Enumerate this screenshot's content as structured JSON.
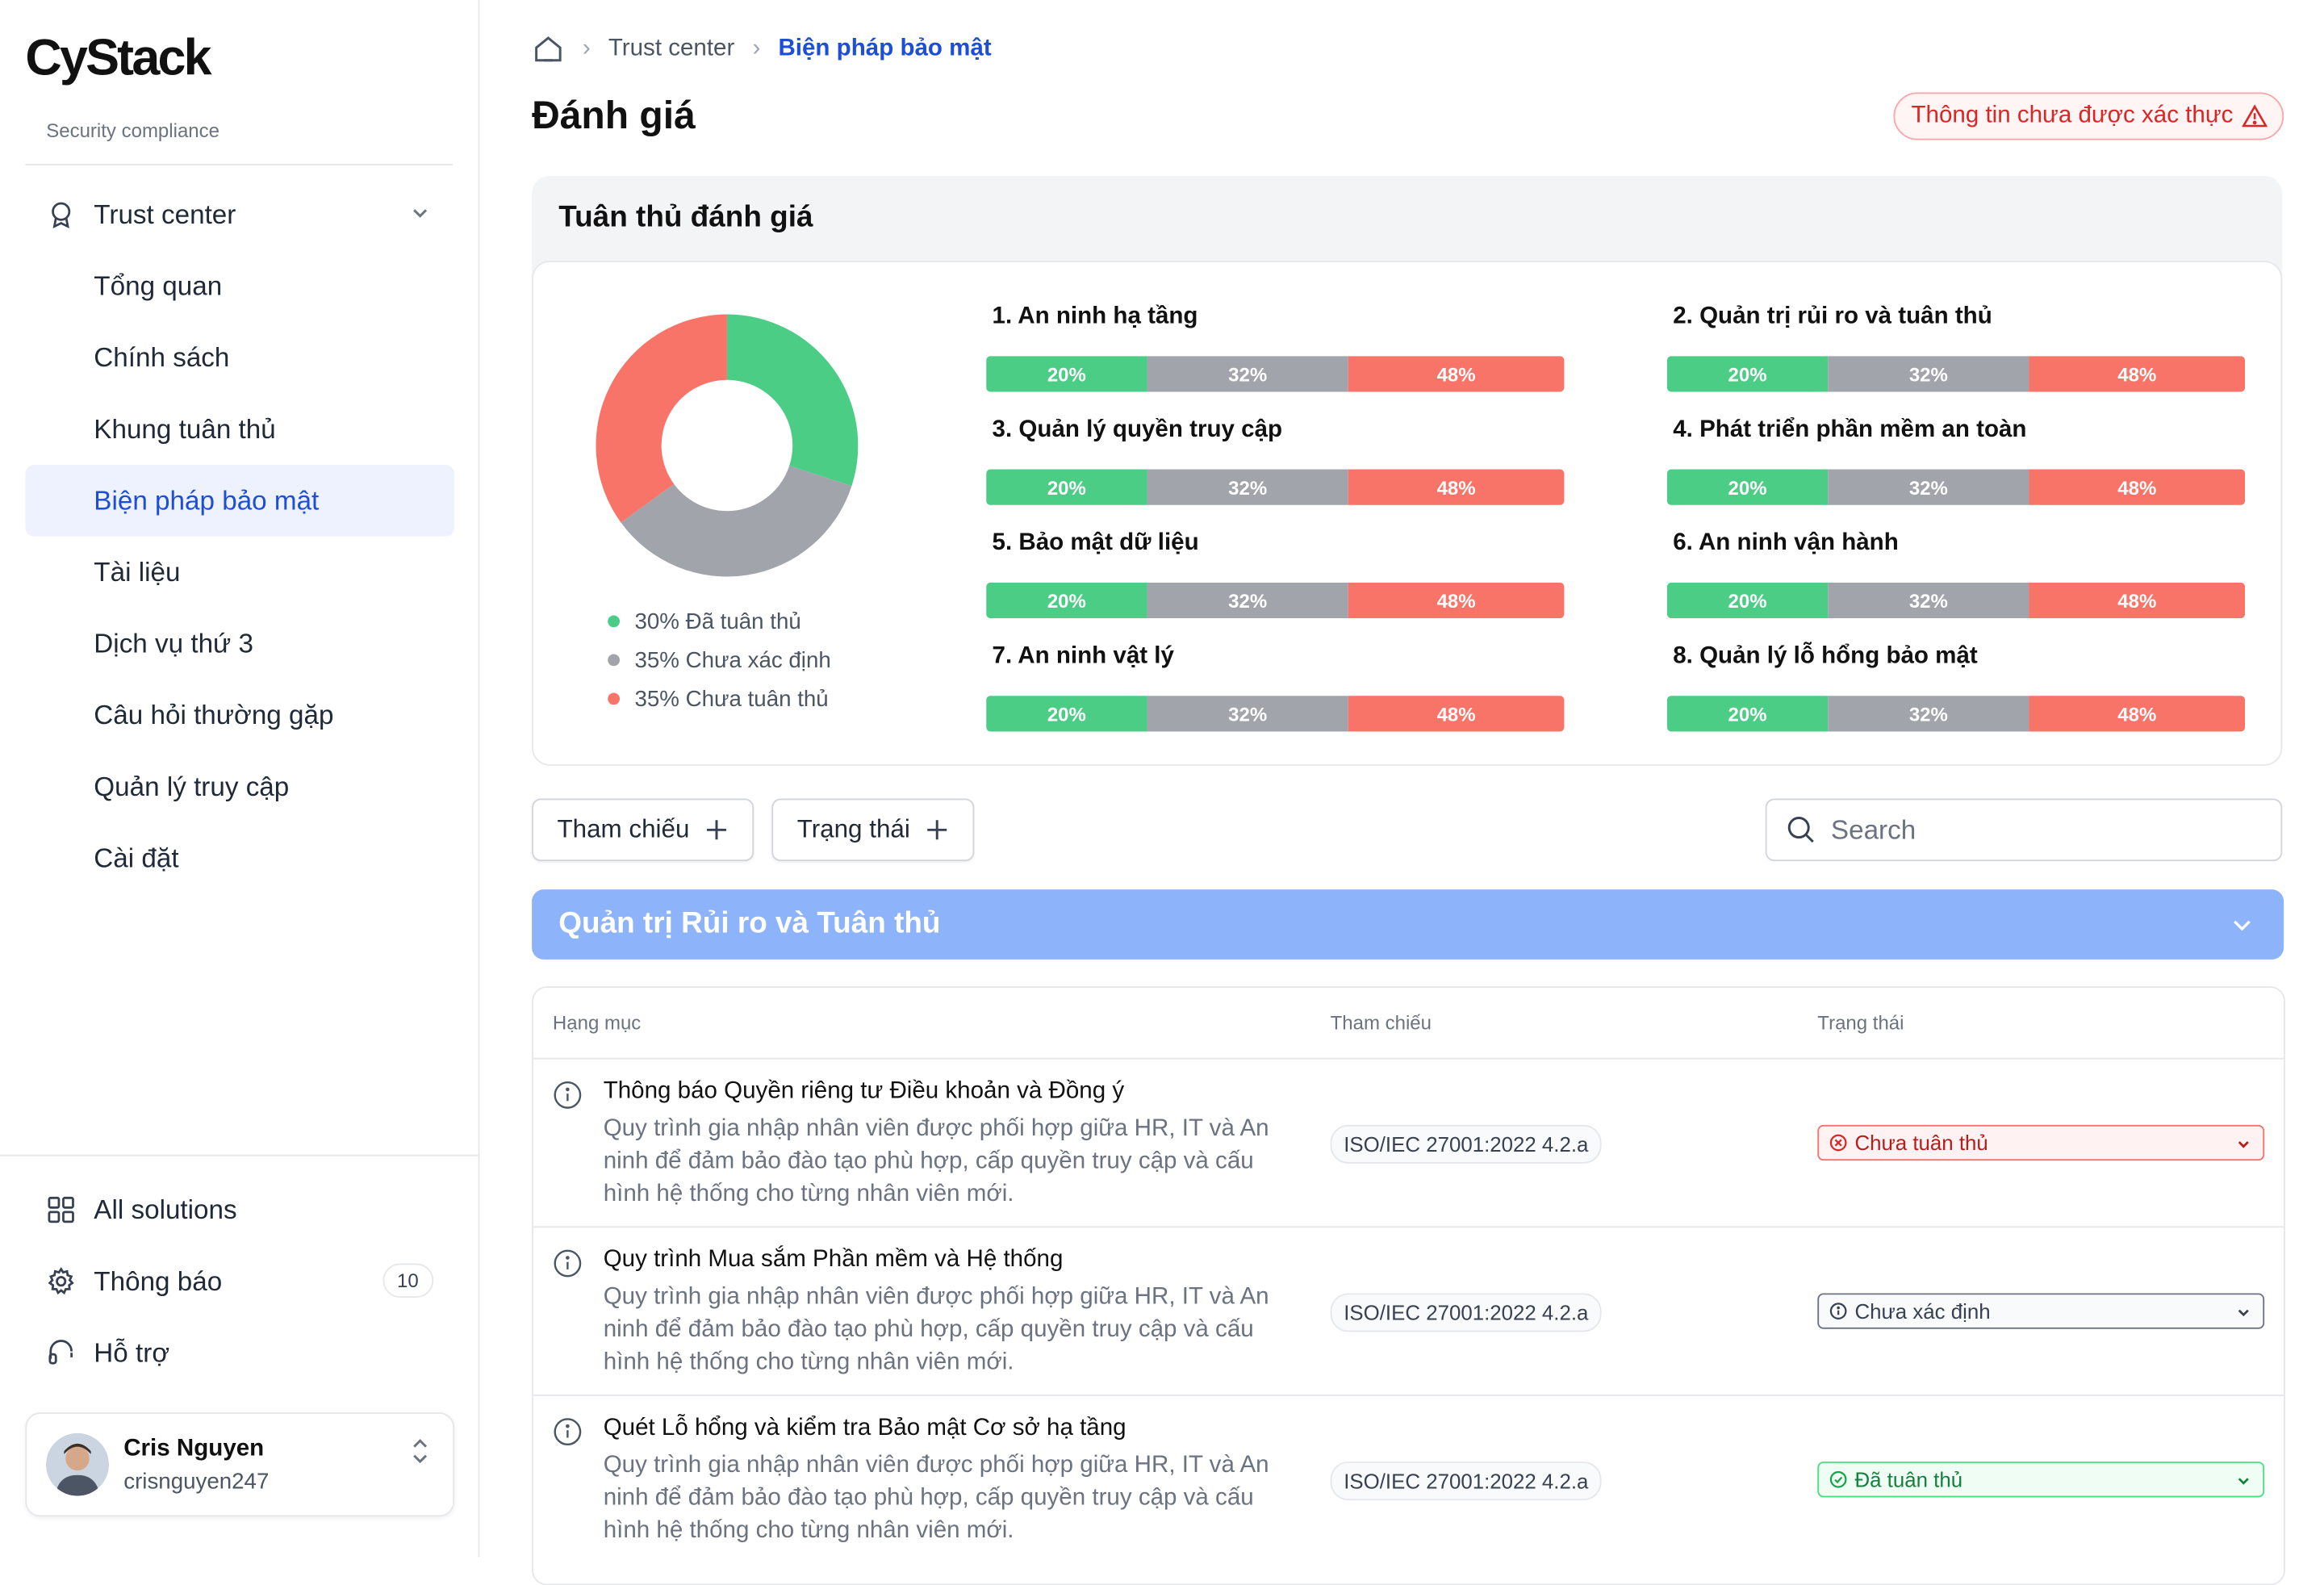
{
  "brand": {
    "logo_text": "CyStack",
    "subtitle": "Security compliance"
  },
  "sidebar": {
    "group": {
      "label": "Trust center",
      "icon": "award-icon"
    },
    "items": [
      {
        "label": "Tổng quan"
      },
      {
        "label": "Chính sách"
      },
      {
        "label": "Khung tuân thủ"
      },
      {
        "label": "Biện pháp bảo mật",
        "active": true
      },
      {
        "label": "Tài liệu"
      },
      {
        "label": "Dịch vụ thứ 3"
      },
      {
        "label": "Câu hỏi thường gặp"
      },
      {
        "label": "Quản lý truy cập"
      },
      {
        "label": "Cài đặt"
      }
    ],
    "bottom": [
      {
        "label": "All solutions",
        "icon": "grid-icon"
      },
      {
        "label": "Thông báo",
        "icon": "gear-icon",
        "badge": "10"
      },
      {
        "label": "Hỗ trợ",
        "icon": "headset-icon"
      }
    ],
    "user": {
      "name": "Cris Nguyen",
      "handle": "crisnguyen247"
    }
  },
  "breadcrumb": {
    "home_icon": "home-icon",
    "parent": "Trust center",
    "current": "Biện pháp bảo mật"
  },
  "page": {
    "title": "Đánh giá",
    "warning": "Thông tin chưa được xác thực"
  },
  "compliance": {
    "title": "Tuân thủ đánh giá",
    "legend": [
      {
        "label": "30% Đã tuân thủ",
        "color": "#4ccd86"
      },
      {
        "label": "35% Chưa xác định",
        "color": "#a1a4ab"
      },
      {
        "label": "35% Chưa tuân thủ",
        "color": "#f87468"
      }
    ],
    "categories": [
      {
        "label": "1. An ninh hạ tầng",
        "values": [
          "20%",
          "32%",
          "48%"
        ]
      },
      {
        "label": "2. Quản trị rủi ro và tuân thủ",
        "values": [
          "20%",
          "32%",
          "48%"
        ]
      },
      {
        "label": "3. Quản lý quyền truy cập",
        "values": [
          "20%",
          "32%",
          "48%"
        ]
      },
      {
        "label": "4. Phát triển phần mềm an toàn",
        "values": [
          "20%",
          "32%",
          "48%"
        ]
      },
      {
        "label": "5. Bảo mật dữ liệu",
        "values": [
          "20%",
          "32%",
          "48%"
        ]
      },
      {
        "label": "6. An ninh vận hành",
        "values": [
          "20%",
          "32%",
          "48%"
        ]
      },
      {
        "label": "7. An ninh vật lý",
        "values": [
          "20%",
          "32%",
          "48%"
        ]
      },
      {
        "label": "8. Quản lý lỗ hổng bảo mật",
        "values": [
          "20%",
          "32%",
          "48%"
        ]
      }
    ],
    "bar_colors": [
      "#4ccd86",
      "#a1a4ab",
      "#f87468"
    ]
  },
  "chart_data": {
    "type": "pie",
    "categories": [
      "Đã tuân thủ",
      "Chưa xác định",
      "Chưa tuân thủ"
    ],
    "values": [
      30,
      35,
      35
    ],
    "colors": [
      "#4ccd86",
      "#a1a4ab",
      "#f87468"
    ],
    "title": ""
  },
  "filters": {
    "reference_label": "Tham chiếu",
    "status_label": "Trạng thái",
    "search_placeholder": "Search"
  },
  "section": {
    "title": "Quản trị Rủi ro và Tuân thủ"
  },
  "table": {
    "headers": [
      "Hạng mục",
      "Tham chiếu",
      "Trạng thái"
    ],
    "rows": [
      {
        "title": "Thông báo Quyền riêng tư Điều khoản và Đồng ý",
        "desc": "Quy trình gia nhập nhân viên được phối hợp giữa HR, IT và An ninh để đảm bảo đào tạo phù hợp, cấp quyền truy cập và cấu hình hệ thống cho từng nhân viên mới.",
        "ref": "ISO/IEC 27001:2022 4.2.a",
        "status": "Chưa tuân thủ",
        "status_type": "red"
      },
      {
        "title": "Quy trình Mua sắm Phần mềm và Hệ thống",
        "desc": "Quy trình gia nhập nhân viên được phối hợp giữa HR, IT và An ninh để đảm bảo đào tạo phù hợp, cấp quyền truy cập và cấu hình hệ thống cho từng nhân viên mới.",
        "ref": "ISO/IEC 27001:2022 4.2.a",
        "status": "Chưa xác định",
        "status_type": "gray"
      },
      {
        "title": "Quét Lỗ hổng và kiểm tra Bảo mật Cơ sở hạ tầng",
        "desc": "Quy trình gia nhập nhân viên được phối hợp giữa HR, IT và An ninh để đảm bảo đào tạo phù hợp, cấp quyền truy cập và cấu hình hệ thống cho từng nhân viên mới.",
        "ref": "ISO/IEC 27001:2022 4.2.a",
        "status": "Đã tuân thủ",
        "status_type": "green"
      }
    ]
  }
}
